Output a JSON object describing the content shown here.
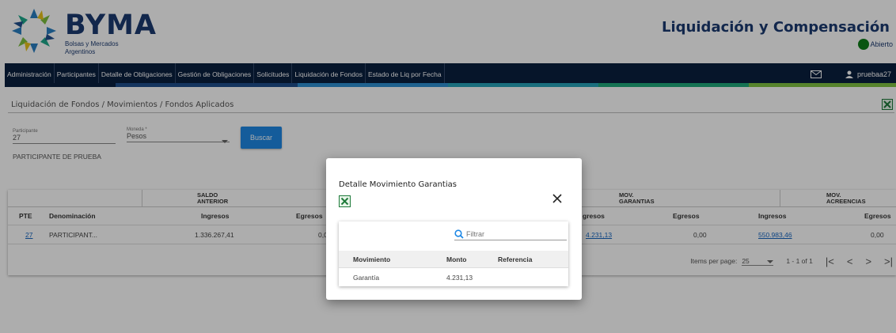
{
  "header": {
    "brand_name": "BYMA",
    "brand_sub_line1": "Bolsas y Mercados",
    "brand_sub_line2": "Argentinos",
    "app_title": "Liquidación y Compensación",
    "status_label": "Abierto",
    "status_color": "#0e7e19",
    "logo_icon": "byma-logo-icon"
  },
  "nav": {
    "items": [
      "Administración",
      "Participantes",
      "Detalle de Obligaciones",
      "Gestión de Obligaciones",
      "Solicitudes",
      "Liquidación de Fondos",
      "Estado de Liq por Fecha"
    ],
    "mail_icon": "mail-icon",
    "user_icon": "user-icon",
    "username": "pruebaa27",
    "background_color": "#0a1f3f",
    "stripe_colors": [
      "#1f4e8c",
      "#2f8fd1",
      "#27a3b9",
      "#20a87b",
      "#7fc241"
    ]
  },
  "page": {
    "breadcrumb": "Liquidación de Fondos / Movimientos / Fondos Aplicados",
    "excel_icon": "excel-icon"
  },
  "form": {
    "participante_label": "Participante",
    "participante_value": "27",
    "participante_name": "PARTICIPANTE DE PRUEBA",
    "moneda_label": "Moneda *",
    "moneda_value": "Pesos",
    "buscar_label": "Buscar"
  },
  "table": {
    "groups": {
      "saldo_line1": "SALDO",
      "saldo_line2": "ANTERIOR",
      "mov_gar_line1": "MOV.",
      "mov_gar_line2": "GARANTIAS",
      "mov_acr_line1": "MOV.",
      "mov_acr_line2": "ACREENCIAS"
    },
    "columns": {
      "pte": "PTE",
      "denominacion": "Denominación",
      "saldo_ingresos": "Ingresos",
      "saldo_egresos": "Egresos",
      "gar_ingresos": "gresos",
      "gar_egresos": "Egresos",
      "acr_ingresos": "Ingresos",
      "acr_egresos": "Egresos"
    },
    "row": {
      "pte": "27",
      "denominacion": "PARTICIPANT...",
      "saldo_ingresos": "1.336.267,41",
      "saldo_egresos": "0,0",
      "gar_ingresos": "4.231,13",
      "gar_egresos": "0,00",
      "acr_ingresos": "550.983,46",
      "acr_egresos": "0,00"
    },
    "paginator": {
      "items_per_page_label": "Items per page:",
      "page_size": "25",
      "range": "1 - 1 of 1",
      "first_icon": "first-page-icon",
      "prev_icon": "prev-page-icon",
      "next_icon": "next-page-icon",
      "last_icon": "last-page-icon"
    }
  },
  "dialog": {
    "title": "Detalle Movimiento Garantias",
    "excel_icon": "excel-icon",
    "close_icon": "close-icon",
    "filter_placeholder": "Filtrar",
    "search_icon": "search-icon",
    "columns": {
      "movimiento": "Movimiento",
      "monto": "Monto",
      "referencia": "Referencia"
    },
    "rows": [
      {
        "movimiento": "Garantía",
        "monto": "4.231,13",
        "referencia": ""
      }
    ]
  }
}
